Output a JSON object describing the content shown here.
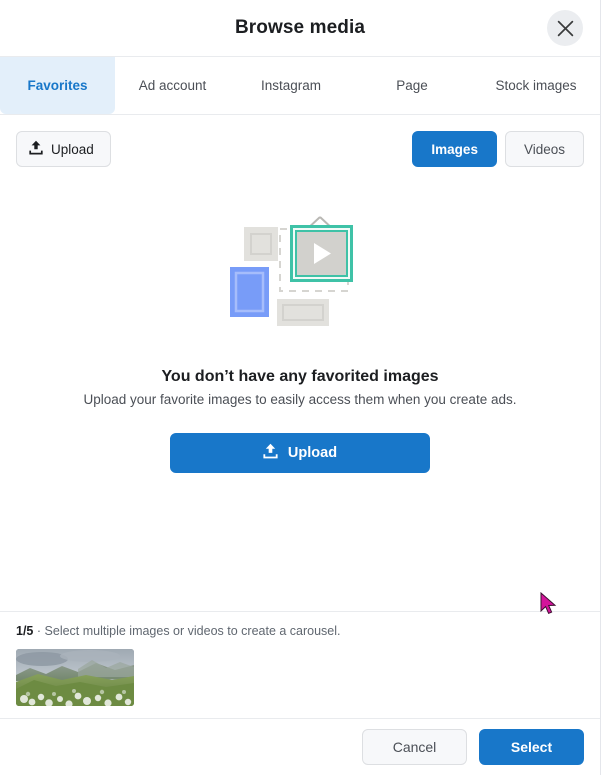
{
  "dialog": {
    "title": "Browse media",
    "close_icon": "close-icon"
  },
  "tabs": [
    {
      "label": "Favorites",
      "active": true
    },
    {
      "label": "Ad account",
      "active": false
    },
    {
      "label": "Instagram",
      "active": false
    },
    {
      "label": "Page",
      "active": false
    },
    {
      "label": "Stock images",
      "active": false
    }
  ],
  "toolbar": {
    "upload_label": "Upload",
    "upload_icon": "upload-icon",
    "media_type_options": [
      "Images",
      "Videos"
    ],
    "media_type_selected": "Images",
    "images_label": "Images",
    "videos_label": "Videos"
  },
  "empty_state": {
    "illustration": "media-frames-illustration",
    "title": "You don’t have any favorited images",
    "subtitle": "Upload your favorite images to easily access them when you create ads.",
    "cta_label": "Upload",
    "cta_icon": "upload-icon"
  },
  "carousel_strip": {
    "count": "1/5",
    "separator": "·",
    "hint": "Select multiple images or videos to create a carousel.",
    "caption_full": "1/5 · Select multiple images or videos to create a carousel.",
    "thumbnail_alt": "mountain-landscape-thumbnail"
  },
  "footer": {
    "cancel_label": "Cancel",
    "select_label": "Select"
  },
  "colors": {
    "primary_blue": "#1877c9",
    "active_tab_bg": "#e3effa",
    "active_tab_text": "#1877c9",
    "text_primary": "#1c1e21",
    "text_secondary": "#4b4f56",
    "border": "#e9ebee",
    "button_bg": "#f7f8fa",
    "illustration_gray": "#e2e1dd",
    "illustration_blue": "#789cf8",
    "illustration_teal": "#3fc2a7",
    "cursor": "#d4149b"
  }
}
